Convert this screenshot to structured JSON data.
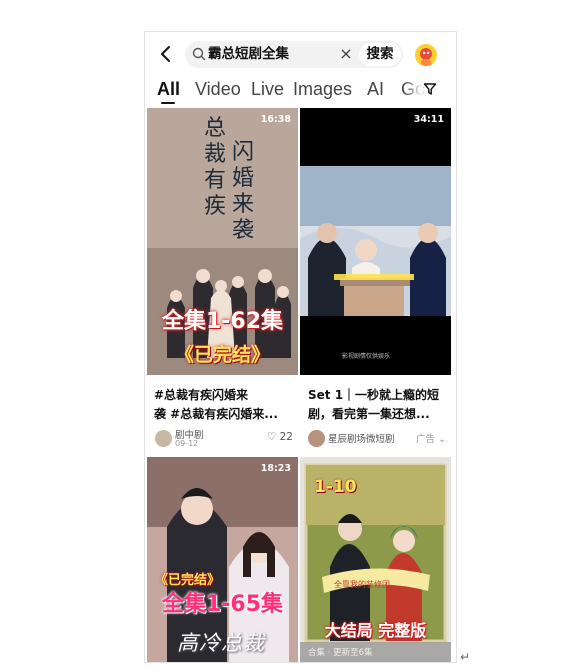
{
  "search": {
    "query": "霸总短剧全集",
    "clear": "×",
    "submit": "搜索"
  },
  "tabs": [
    {
      "label": "All",
      "active": true
    },
    {
      "label": "Video"
    },
    {
      "label": "Live"
    },
    {
      "label": "Images"
    },
    {
      "label": "AI"
    },
    {
      "label": "Gc"
    }
  ],
  "icons": {
    "back": "chevron-left-icon",
    "search": "search-icon",
    "filter": "filter-icon",
    "avatar": "avatar-icon"
  },
  "results": [
    {
      "duration": "16:38",
      "overlay": [
        "总",
        "裁",
        "有",
        "疾",
        "闪",
        "婚",
        "来",
        "袭"
      ],
      "banner": "全集1-62集",
      "tag": "《已完结》",
      "title_lines": [
        "#总裁有疾闪婚来",
        "袭 #总裁有疾闪婚来..."
      ],
      "author": "剧中剧",
      "date": "09-12",
      "likes": "♡ 22"
    },
    {
      "duration": "34:11",
      "title_lines": [
        "Set 1｜一秒就上瘾的短",
        "剧，看完第一集还想..."
      ],
      "author": "星辰剧场微短剧",
      "ad": "广告 ⌄"
    },
    {
      "duration": "18:23",
      "tag": "《已完结》",
      "banner": "全集1-65集",
      "overlay": "高冷总裁"
    },
    {
      "badge": "1-10",
      "banner": "大结局 完整版",
      "caption": "合集 · 更新至6集"
    }
  ],
  "colors": {
    "accent": "#111111",
    "banner_red": "#e8312d",
    "tag_gold": "#ffd54a",
    "tab_grey": "#444444"
  }
}
